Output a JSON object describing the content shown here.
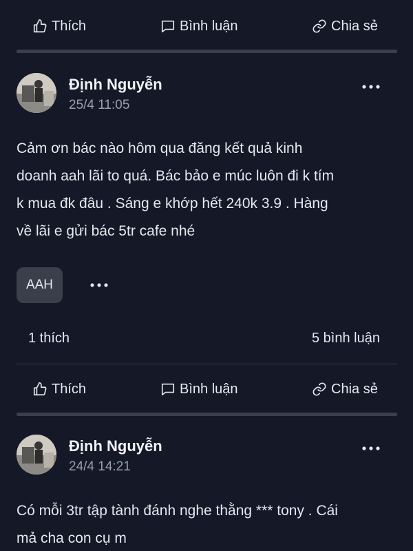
{
  "actions": {
    "like_label": "Thích",
    "comment_label": "Bình luận",
    "share_label": "Chia sẻ"
  },
  "posts": [
    {
      "author": "Định Nguyễn",
      "timestamp": "25/4 11:05",
      "text": "Cảm ơn bác nào hôm qua đăng kết quả kinh\ndoanh aah lãi to quá. Bác bảo e múc luôn đi k tím\nk mua đk đâu . Sáng e khớp hết 240k 3.9 . Hàng\nvề lãi e gửi bác 5tr cafe nhé",
      "tag": "AAH",
      "likes": "1 thích",
      "comments": "5 bình luận"
    },
    {
      "author": "Định Nguyễn",
      "timestamp": "24/4 14:21",
      "text": "Có mỗi 3tr tập tành đánh nghe thằng *** tony . Cái\nmả cha con cụ m"
    }
  ],
  "colors": {
    "background": "#141827",
    "divider": "#3a3f4c",
    "text_primary": "#e6e8ee",
    "text_secondary": "#9aa0ad"
  },
  "icons": [
    "thumbs-up-icon",
    "comment-icon",
    "link-icon",
    "more-horizontal-icon"
  ]
}
